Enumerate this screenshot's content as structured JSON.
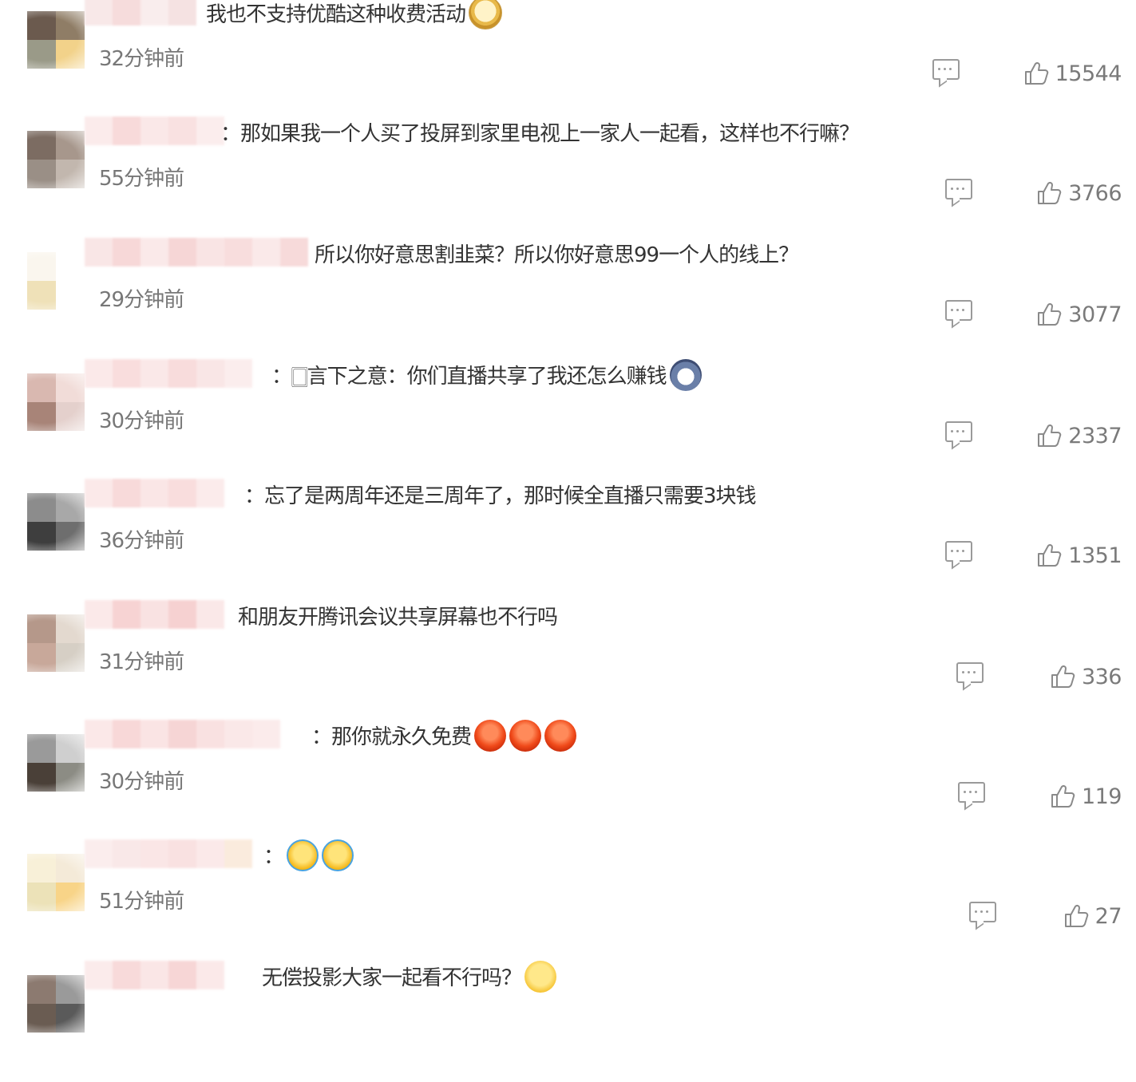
{
  "comments": [
    {
      "text": "我也不支持优酷这种收费活动",
      "emoji": [
        "doge-emoji"
      ],
      "time": "32分钟前",
      "likes": "15544",
      "avatar_colors": [
        "#6b5a4e",
        "#8f7d66",
        "#9a9a88",
        "#f2d28a"
      ],
      "name_colors": [
        "#f7e4e4",
        "#f5d6d6",
        "#f9eaea",
        "#f4dede"
      ]
    },
    {
      "text": "：那如果我一个人买了投屏到家里电视上一家人一起看，这样也不行嘛？",
      "emoji": [],
      "time": "55分钟前",
      "likes": "3766",
      "avatar_colors": [
        "#7c6c62",
        "#a7978c",
        "#9a8f86",
        "#c2b7ae"
      ],
      "name_colors": [
        "#fbe8e8",
        "#f7d4d4",
        "#fae4e4",
        "#f8dcdc",
        "#fbeaea"
      ]
    },
    {
      "text": "所以你好意思割韭菜？所以你好意思99一个人的线上？",
      "emoji": [],
      "time": "29分钟前",
      "likes": "3077",
      "avatar_colors": [
        "#faf6ee",
        "#ffffff",
        "#efe1b8",
        "#ffffff"
      ],
      "name_colors": [
        "#f9e2e2",
        "#f6d2d2",
        "#fae6e6",
        "#f5d0d0",
        "#f9e0e0",
        "#f7d8d8",
        "#fae6e6",
        "#f6d4d4"
      ]
    },
    {
      "text": "：🀆言下之意：你们直播共享了我还怎么赚钱",
      "emoji": [
        "husky-emoji"
      ],
      "time": "30分钟前",
      "likes": "2337",
      "avatar_colors": [
        "#d9b8b0",
        "#f1dcd8",
        "#a88478",
        "#e4d0cc"
      ],
      "name_colors": [
        "#fbe6e6",
        "#f8d8d8",
        "#fae4e4",
        "#f7d6d6",
        "#f9e2e2",
        "#fbeaea"
      ]
    },
    {
      "text": "：忘了是两周年还是三周年了，那时候全直播只需要3块钱",
      "emoji": [],
      "time": "36分钟前",
      "likes": "1351",
      "avatar_colors": [
        "#8c8c8c",
        "#a8a8a8",
        "#3e3e3e",
        "#6e6e6e"
      ],
      "name_colors": [
        "#fbe6e6",
        "#f7d4d4",
        "#fae2e2",
        "#f8d8d8",
        "#fbe8e8"
      ]
    },
    {
      "text": "和朋友开腾讯会议共享屏幕也不行吗",
      "emoji": [],
      "time": "31分钟前",
      "likes": "336",
      "avatar_colors": [
        "#b5988a",
        "#e3d9cf",
        "#c8a89a",
        "#d6cfc5"
      ],
      "name_colors": [
        "#fbe6e6",
        "#f6cccc",
        "#f9dede",
        "#f5caca",
        "#fae4e4"
      ]
    },
    {
      "text": "：那你就永久免费",
      "emoji": [
        "angry-emoji",
        "angry-emoji",
        "angry-emoji"
      ],
      "time": "30分钟前",
      "likes": "119",
      "avatar_colors": [
        "#9a9a9a",
        "#cfcfcf",
        "#4a4038",
        "#8c8c84"
      ],
      "name_colors": [
        "#fbe4e4",
        "#f7d2d2",
        "#fae0e0",
        "#f5cece",
        "#f9dcdc",
        "#fae4e4",
        "#fbe8e8"
      ]
    },
    {
      "text": "：",
      "emoji": [
        "laugh-cry-emoji",
        "laugh-cry-emoji"
      ],
      "time": "51分钟前",
      "likes": "27",
      "avatar_colors": [
        "#f8f0d8",
        "#f4ead8",
        "#ece2b8",
        "#f8d488"
      ],
      "name_colors": [
        "#fbeaea",
        "#f9e4e4",
        "#fae2e2",
        "#f8dcdc",
        "#fbe6e6",
        "#fae8d8"
      ]
    },
    {
      "text": "无偿投影大家一起看不行吗？",
      "emoji": [
        "sweat-emoji"
      ],
      "time": "",
      "likes": "",
      "avatar_colors": [
        "#8c7a70",
        "#9a9a9a",
        "#6a5c52",
        "#5a5a5a"
      ],
      "name_colors": [
        "#fbe8e8",
        "#f7d4d4",
        "#fae2e2",
        "#f6d0d0",
        "#fbe6e6"
      ]
    }
  ]
}
